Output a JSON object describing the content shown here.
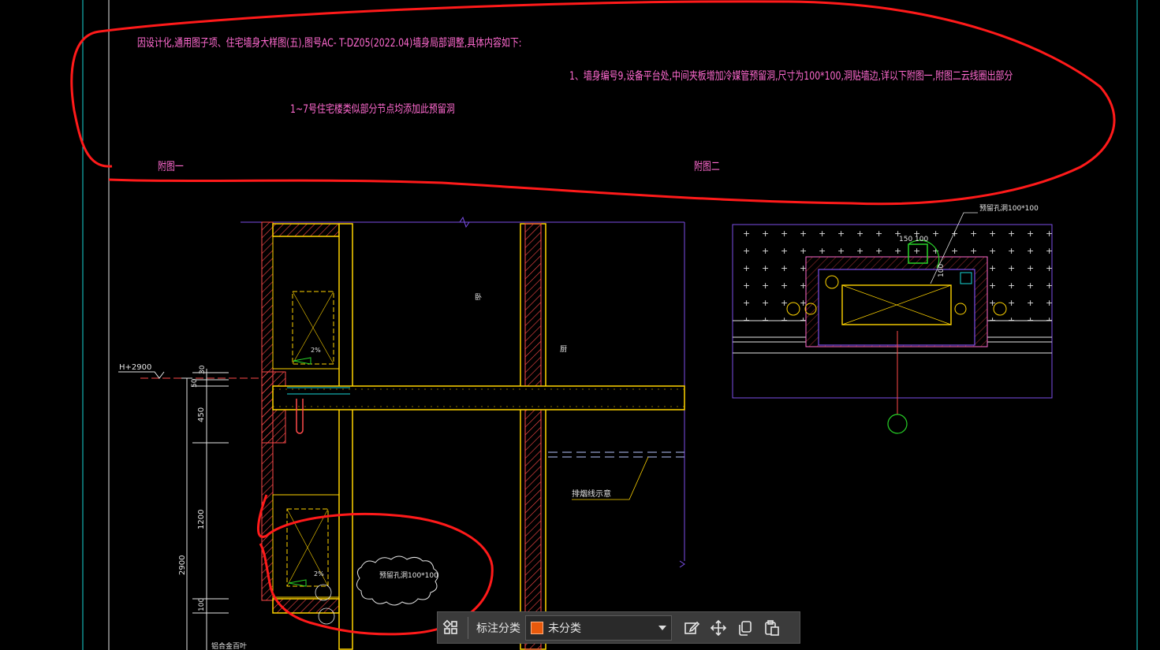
{
  "notes": {
    "line1": "因设计化,通用图子项、住宅墙身大样图(五),图号AC- T-DZ05(2022.04)墙身局部调整,具体内容如下:",
    "line2": "1、墙身编号9,设备平台处,中间夹板增加冷媒管预留洞,尺寸为100*100,洞贴墙边,详以下附图一,附图二云线圈出部分",
    "line3": "1~7号住宅楼类似部分节点均添加此预留洞",
    "fig1_label": "附图一",
    "fig2_label": "附图二"
  },
  "drawing_left": {
    "elevation_label": "H+2900",
    "dim_30": "30",
    "dim_50": "50",
    "dim_450": "450",
    "dim_1200": "1200",
    "dim_2900": "2900",
    "dim_100": "100",
    "slope_upper": "2%",
    "slope_lower": "2%",
    "room_upper": "卧",
    "room_right": "厨",
    "line_note": "排烟线示意",
    "hole_note": "预留孔洞100*100",
    "bottom_note": "铝合金百叶"
  },
  "drawing_right": {
    "hole_note": "预留孔洞100*100",
    "dim_150_100": "150 100",
    "dim_100v": "100"
  },
  "toolbar": {
    "label": "标注分类",
    "category_value": "未分类",
    "category_color": "#e8590c",
    "icons": [
      "grid-icon",
      "edit-icon",
      "move-icon",
      "copy-icon",
      "paste-icon"
    ]
  },
  "colors": {
    "background": "#000000",
    "annotation_cloud": "#ff1a1a",
    "note_text": "#ff6ad0",
    "wall": "#ffd400",
    "frame": "#7b4ee8",
    "dimension": "#e6e6e6",
    "green": "#27d227"
  }
}
